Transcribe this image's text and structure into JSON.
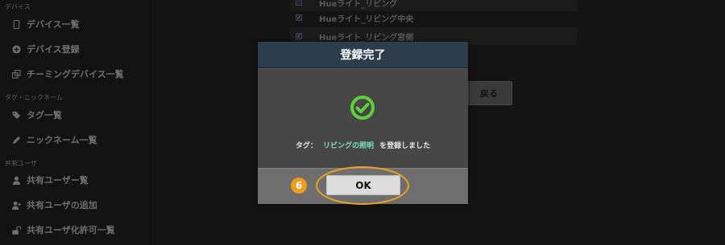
{
  "sidebar": {
    "section_devices": "デバイス",
    "device_list": "デバイス一覧",
    "device_register": "デバイス登録",
    "teaming_list": "チーミングデバイス一覧",
    "section_tags": "タグ・ニックネーム",
    "tag_list": "タグ一覧",
    "nickname_list": "ニックネーム一覧",
    "section_shared": "共有ユーザ",
    "shared_users": "共有ユーザー覧",
    "add_shared_user": "共有ユーザの追加",
    "shared_permission_list": "共有ユーザ化許可一覧"
  },
  "device_rows": [
    {
      "name": "Hueライト_リビング",
      "checked": false
    },
    {
      "name": "Hueライト_リビング中央",
      "checked": true
    },
    {
      "name": "Hueライト_リビング窓側",
      "checked": true
    }
  ],
  "back_button": "戻る",
  "modal": {
    "title": "登録完了",
    "message_prefix": "タグ：",
    "tag_name": "リビングの照明",
    "message_suffix": "を登録しました",
    "ok_label": "OK"
  },
  "annotation": {
    "step": "6",
    "color": "#f29a1a"
  },
  "colors": {
    "modal_header": "#2e3d4d",
    "success_green": "#5fd13a",
    "tag_highlight": "#7fe0c3"
  }
}
